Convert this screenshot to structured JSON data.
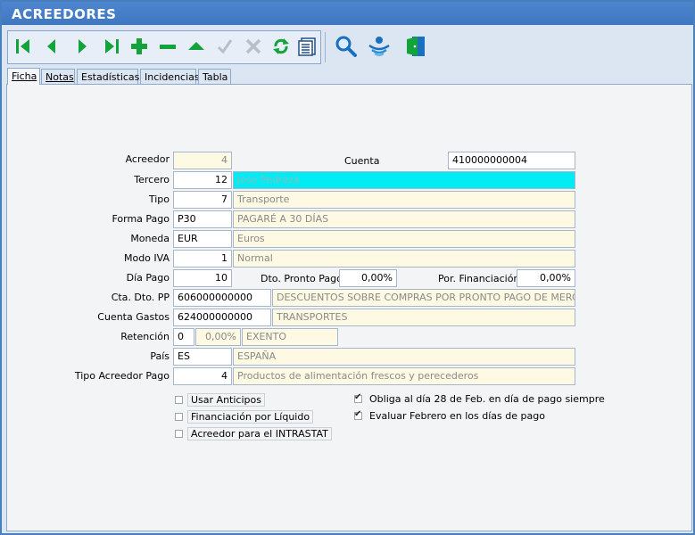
{
  "window": {
    "title": "ACREEDORES"
  },
  "toolbar": {
    "buttons": [
      "first-icon",
      "prev-icon",
      "next-icon",
      "last-icon",
      "add-icon",
      "remove-icon",
      "up-icon",
      "confirm-icon",
      "cancel-icon",
      "refresh-icon",
      "list-icon"
    ],
    "extra": [
      "search-icon",
      "filter-icon",
      "exit-door-icon"
    ]
  },
  "colors": {
    "green": "#12a43a",
    "gray": "#b9bfc6",
    "blue": "#1a6fbf",
    "title": "#ffffff"
  },
  "tabs": [
    {
      "label": "Ficha",
      "active": true
    },
    {
      "label": "Notas"
    },
    {
      "label": "Estadísticas"
    },
    {
      "label": "Incidencias"
    },
    {
      "label": "Tabla"
    }
  ],
  "form": {
    "acreedor": {
      "label": "Acreedor",
      "value": "4"
    },
    "cuenta": {
      "label": "Cuenta",
      "value": "410000000004"
    },
    "tercero": {
      "label": "Tercero",
      "code": "12",
      "name": "Jose Pedraza"
    },
    "tipo": {
      "label": "Tipo",
      "code": "7",
      "name": "Transporte"
    },
    "forma_pago": {
      "label": "Forma Pago",
      "code": "P30",
      "name": "PAGARÉ A 30 DÍAS"
    },
    "moneda": {
      "label": "Moneda",
      "code": "EUR",
      "name": "Euros"
    },
    "modo_iva": {
      "label": "Modo IVA",
      "code": "1",
      "name": "Normal"
    },
    "dia_pago": {
      "label": "Día Pago",
      "value": "10"
    },
    "dto_pronto_pago": {
      "label": "Dto. Pronto Pago",
      "value": "0,00%"
    },
    "por_financiacion": {
      "label": "Por. Financiación",
      "value": "0,00%"
    },
    "cta_dto_pp": {
      "label": "Cta. Dto. PP",
      "code": "606000000000",
      "name": "DESCUENTOS SOBRE COMPRAS POR PRONTO PAGO DE MERC"
    },
    "cuenta_gastos": {
      "label": "Cuenta Gastos",
      "code": "624000000000",
      "name": "TRANSPORTES"
    },
    "retencion": {
      "label": "Retención",
      "code": "0",
      "pct": "0,00%",
      "name": "EXENTO"
    },
    "pais": {
      "label": "País",
      "code": "ES",
      "name": "ESPAÑA"
    },
    "tipo_acreedor_pago": {
      "label": "Tipo Acreedor Pago",
      "code": "4",
      "name": "Productos de alimentación frescos y perecederos"
    }
  },
  "checks": {
    "usar_anticipos": {
      "label": "Usar Anticipos",
      "checked": false
    },
    "financiacion_liquido": {
      "label": "Financiación por Líquido",
      "checked": false
    },
    "intrastat": {
      "label": "Acreedor para el INTRASTAT",
      "checked": false
    },
    "obliga_28_feb": {
      "label": "Obliga al día 28 de Feb. en día de pago siempre",
      "checked": true
    },
    "evaluar_febrero": {
      "label": "Evaluar Febrero en los días de pago",
      "checked": true
    }
  }
}
